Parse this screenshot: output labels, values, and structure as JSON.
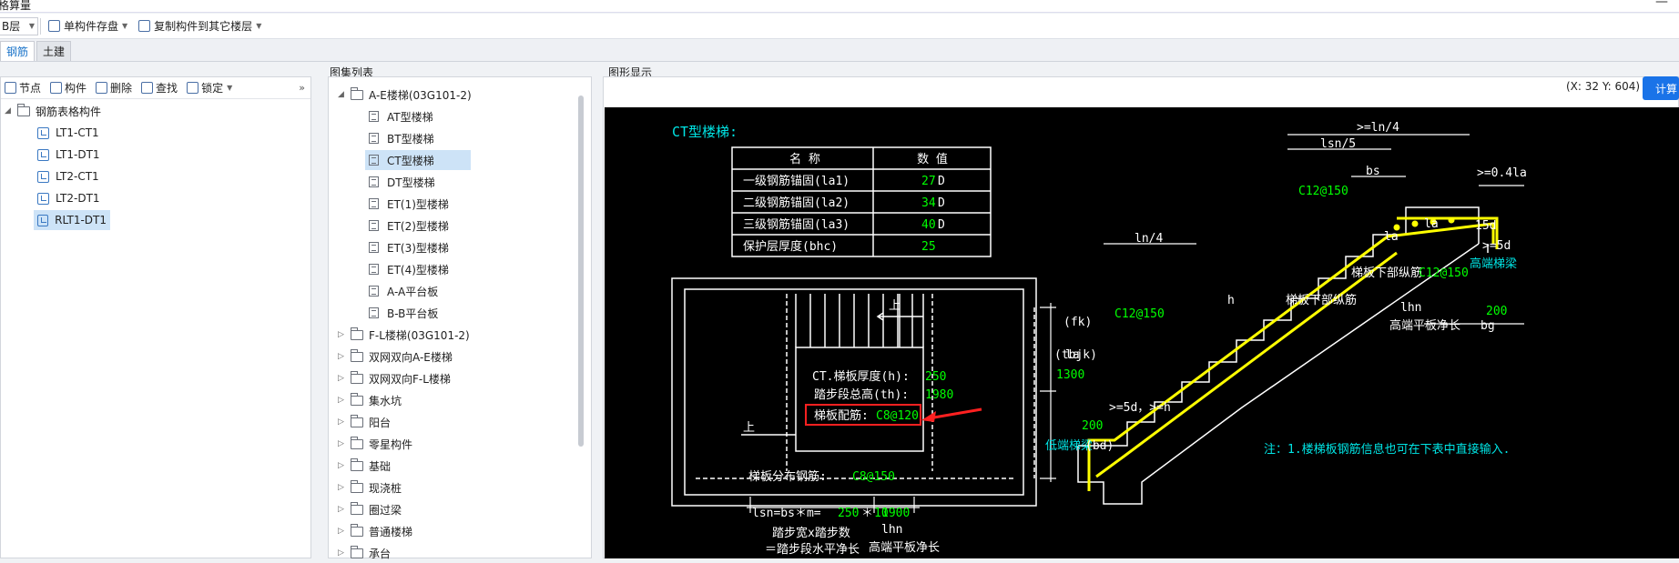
{
  "window": {
    "title": "格算量",
    "minimize": "—"
  },
  "toolbar": {
    "floor": "B层",
    "save_label": "单构件存盘",
    "copy_label": "复制构件到其它楼层"
  },
  "tabs": [
    {
      "label": "钢筋"
    },
    {
      "label": "土建"
    }
  ],
  "left_panel": {
    "tools": {
      "node": "节点",
      "component": "构件",
      "delete": "删除",
      "find": "查找",
      "lock": "锁定",
      "collapse": "»"
    },
    "root": "钢筋表格构件",
    "items": [
      "LT1-CT1",
      "LT1-DT1",
      "LT2-CT1",
      "LT2-DT1",
      "RLT1-DT1"
    ],
    "selected_index": 4
  },
  "atlas_panel": {
    "label": "图集列表",
    "groups": [
      {
        "label": "A-E楼梯(03G101-2)",
        "expanded": true
      },
      {
        "label": "F-L楼梯(03G101-2)"
      },
      {
        "label": "双网双向A-E楼梯"
      },
      {
        "label": "双网双向F-L楼梯"
      },
      {
        "label": "集水坑"
      },
      {
        "label": "阳台"
      },
      {
        "label": "零星构件"
      },
      {
        "label": "基础"
      },
      {
        "label": "现浇桩"
      },
      {
        "label": "圈过梁"
      },
      {
        "label": "普通楼梯"
      },
      {
        "label": "承台"
      }
    ],
    "children": [
      "AT型楼梯",
      "BT型楼梯",
      "CT型楼梯",
      "DT型楼梯",
      "ET(1)型楼梯",
      "ET(2)型楼梯",
      "ET(3)型楼梯",
      "ET(4)型楼梯",
      "A-A平台板",
      "B-B平台板"
    ],
    "selected_child": 2
  },
  "graphic_panel": {
    "label": "图形显示",
    "coords": "(X: 32 Y: 604)",
    "calc_button": "计算"
  },
  "drawing": {
    "title": "CT型楼梯:",
    "table_headers": [
      "名  称",
      "数  值"
    ],
    "table_rows": [
      {
        "name": "一级钢筋锚固(la1)",
        "value": "27",
        "unit": "D"
      },
      {
        "name": "二级钢筋锚固(la2)",
        "value": "34",
        "unit": "D"
      },
      {
        "name": "三级钢筋锚固(la3)",
        "value": "40",
        "unit": "D"
      },
      {
        "name": "保护层厚度(bhc)",
        "value": "25",
        "unit": ""
      }
    ],
    "plan": {
      "up1": "上",
      "up2": "上",
      "thickness_label": "CT.梯板厚度(h):",
      "thickness_value": "250",
      "height_label": "踏步段总高(th):",
      "height_value": "1980",
      "rebar_label": "梯板配筋:",
      "rebar_value": "C8@120",
      "fk": "(fk)",
      "tbjk": "(tbjk)",
      "tbjk_value": "1300",
      "lsn_label": "lsn=bs＊m=",
      "bs_value": "250",
      "times": "＊",
      "m_value": "10",
      "lhn_value": "1900",
      "lhn": "lhn",
      "step_desc1": "踏步宽x踏步数",
      "step_desc2": "＝踏步段水平净长",
      "high_plate": "高端平板净长",
      "dist_label": "梯板分布钢筋:",
      "dist_value": "C8@150"
    },
    "section": {
      "ln4_top": ">=ln/4",
      "lsn5": "lsn/5",
      "bs": "bs",
      "ge04la": ">=0.4la",
      "c12_top": "C12@150",
      "la1": "la",
      "la2": "la",
      "d15": "15d",
      "ge5d_r": ">=5d",
      "high_beam": "高端梯梁",
      "ln4": "ln/4",
      "lower_long": "梯板下部纵筋",
      "lower_long2": "梯板下部纵筋",
      "lower_long2_val": "C12@150",
      "h": "h",
      "c12_left": "C12@150",
      "lhn": "lhn",
      "lhn_val": "200",
      "bg": "bg",
      "high_plate_len": "高端平板净长",
      "la_left": "la",
      "ge5d": ">=5d，>=h",
      "bottom_val": "200",
      "low_beam": "低端梯梁",
      "bd": "(bd)",
      "note": "注：1.楼梯板钢筋信息也可在下表中直接输入."
    }
  },
  "colors": {
    "accent": "#1a73e8",
    "cad_green": "#00ff00",
    "cad_cyan": "#00e5e5",
    "cad_yellow": "#ffff00",
    "highlight_red": "#ff2020"
  }
}
